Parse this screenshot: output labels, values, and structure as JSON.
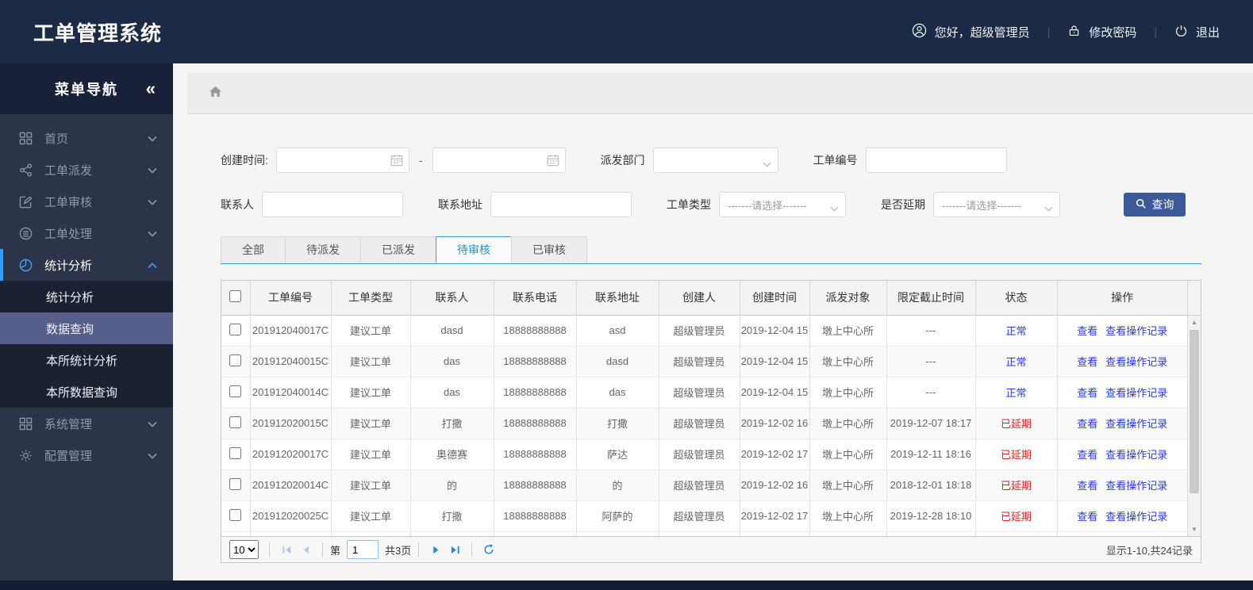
{
  "colors": {
    "header_bg": "#1c2b45",
    "sidebar_bg": "#2b3449",
    "sidebar_active_bg": "#565f8c",
    "accent_blue": "#2e9fff",
    "tab_active_blue": "#2191d0",
    "button_blue": "#3d5a98",
    "link_blue": "#2a3bd8",
    "danger_red": "#e02020"
  },
  "header": {
    "title": "工单管理系统",
    "greeting": "您好，超级管理员",
    "change_password": "修改密码",
    "logout": "退出"
  },
  "sidebar": {
    "title": "菜单导航",
    "collapse_glyph": "«",
    "items": [
      {
        "label": "首页"
      },
      {
        "label": "工单派发"
      },
      {
        "label": "工单审核"
      },
      {
        "label": "工单处理"
      },
      {
        "label": "统计分析"
      },
      {
        "label": "系统管理"
      },
      {
        "label": "配置管理"
      }
    ],
    "submenu": [
      {
        "label": "统计分析"
      },
      {
        "label": "数据查询",
        "active": true
      },
      {
        "label": "本所统计分析"
      },
      {
        "label": "本所数据查询"
      }
    ]
  },
  "filters": {
    "create_time_label": "创建时间:",
    "range_separator": "-",
    "dispatch_dept_label": "派发部门",
    "order_no_label": "工单编号",
    "contact_label": "联系人",
    "address_label": "联系地址",
    "order_type_label": "工单类型",
    "order_type_placeholder": "-------请选择-------",
    "delay_label": "是否延期",
    "delay_placeholder": "-------请选择-------",
    "search_button": "查询"
  },
  "tabs": [
    {
      "label": "全部"
    },
    {
      "label": "待派发"
    },
    {
      "label": "已派发"
    },
    {
      "label": "待审核",
      "active": true
    },
    {
      "label": "已审核"
    }
  ],
  "table": {
    "headers": [
      "工单编号",
      "工单类型",
      "联系人",
      "联系电话",
      "联系地址",
      "创建人",
      "创建时间",
      "派发对象",
      "限定截止时间",
      "状态",
      "操作"
    ],
    "actions": {
      "view": "查看",
      "log": "查看操作记录"
    },
    "rows": [
      {
        "order_no": "201912040017C",
        "type": "建议工单",
        "contact": "dasd",
        "phone": "18888888888",
        "address": "asd",
        "creator": "超级管理员",
        "created": "2019-12-04 15",
        "target": "墩上中心所",
        "deadline": "---",
        "status": "正常",
        "status_state": "normal"
      },
      {
        "order_no": "201912040015C",
        "type": "建议工单",
        "contact": "das",
        "phone": "18888888888",
        "address": "dasd",
        "creator": "超级管理员",
        "created": "2019-12-04 15",
        "target": "墩上中心所",
        "deadline": "---",
        "status": "正常",
        "status_state": "normal"
      },
      {
        "order_no": "201912040014C",
        "type": "建议工单",
        "contact": "das",
        "phone": "18888888888",
        "address": "das",
        "creator": "超级管理员",
        "created": "2019-12-04 15",
        "target": "墩上中心所",
        "deadline": "---",
        "status": "正常",
        "status_state": "normal"
      },
      {
        "order_no": "201912020015C",
        "type": "建议工单",
        "contact": "打撒",
        "phone": "18888888888",
        "address": "打撒",
        "creator": "超级管理员",
        "created": "2019-12-02 16",
        "target": "墩上中心所",
        "deadline": "2019-12-07 18:17",
        "status": "已延期",
        "status_state": "delayed"
      },
      {
        "order_no": "201912020017C",
        "type": "建议工单",
        "contact": "奥德赛",
        "phone": "18888888888",
        "address": "萨达",
        "creator": "超级管理员",
        "created": "2019-12-02 17",
        "target": "墩上中心所",
        "deadline": "2019-12-11 18:16",
        "status": "已延期",
        "status_state": "delayed"
      },
      {
        "order_no": "201912020014C",
        "type": "建议工单",
        "contact": "的",
        "phone": "18888888888",
        "address": "的",
        "creator": "超级管理员",
        "created": "2019-12-02 16",
        "target": "墩上中心所",
        "deadline": "2018-12-01 18:18",
        "status": "已延期",
        "status_state": "delayed"
      },
      {
        "order_no": "201912020025C",
        "type": "建议工单",
        "contact": "打撒",
        "phone": "18888888888",
        "address": "阿萨的",
        "creator": "超级管理员",
        "created": "2019-12-02 17",
        "target": "墩上中心所",
        "deadline": "2019-12-28 18:10",
        "status": "已延期",
        "status_state": "delayed"
      }
    ]
  },
  "pagination": {
    "page_size": "10",
    "page_prefix": "第",
    "current_page": "1",
    "total_pages": "共3页",
    "summary": "显示1-10,共24记录"
  }
}
